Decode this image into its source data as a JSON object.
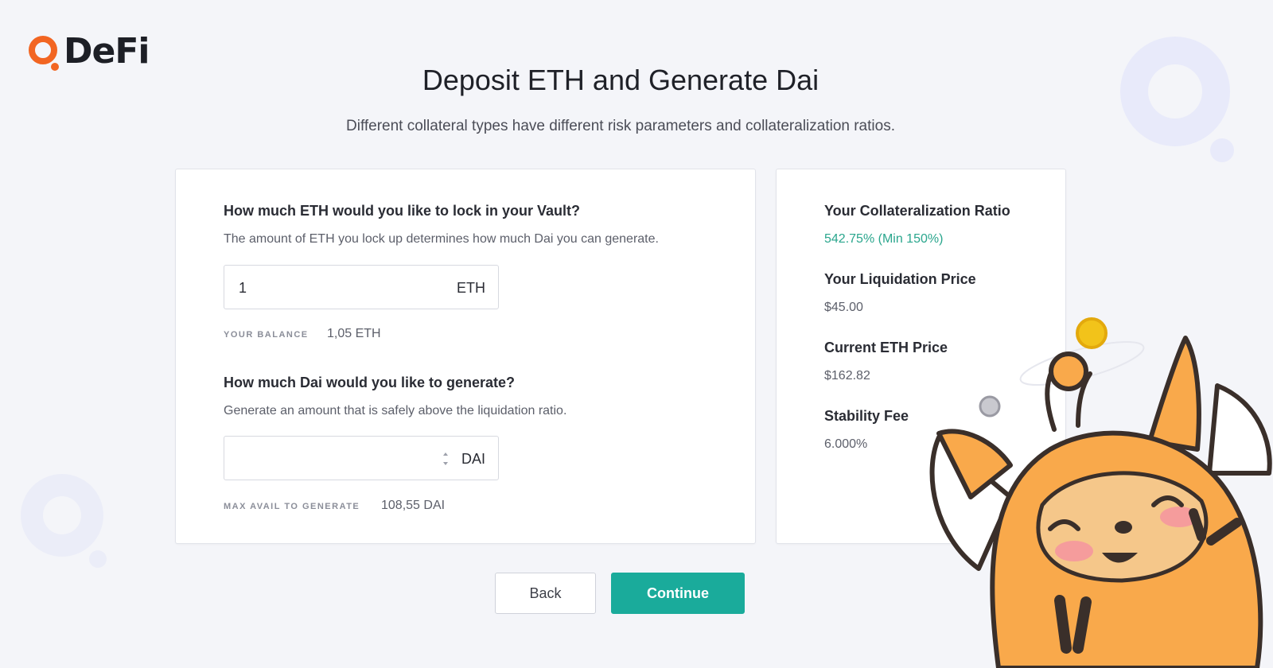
{
  "brand": {
    "logo_text": "DeFi",
    "accent": "#f26522"
  },
  "header": {
    "title": "Deposit ETH and Generate Dai",
    "subtitle": "Different collateral types have different risk parameters and collateralization ratios."
  },
  "eth_section": {
    "question": "How much ETH would you like to lock in your Vault?",
    "description": "The amount of ETH you lock up determines how much Dai you can generate.",
    "input_value": "1",
    "unit": "ETH",
    "balance_label": "YOUR BALANCE",
    "balance_value": "1,05 ETH"
  },
  "dai_section": {
    "question": "How much Dai would you like to generate?",
    "description": "Generate an amount that is safely above the liquidation ratio.",
    "input_value": "",
    "unit": "DAI",
    "max_label": "MAX AVAIL TO GENERATE",
    "max_value": "108,55 DAI"
  },
  "stats": {
    "collateral_ratio_label": "Your Collateralization Ratio",
    "collateral_ratio_value": "542.75% (Min 150%)",
    "liquidation_price_label": "Your Liquidation Price",
    "liquidation_price_value": "$45.00",
    "eth_price_label": "Current ETH Price",
    "eth_price_value": "$162.82",
    "stability_fee_label": "Stability Fee",
    "stability_fee_value": "6.000%"
  },
  "actions": {
    "back_label": "Back",
    "continue_label": "Continue"
  },
  "colors": {
    "primary": "#1aab9b",
    "positive": "#2aa68d",
    "mascot": "#f9a94b"
  }
}
